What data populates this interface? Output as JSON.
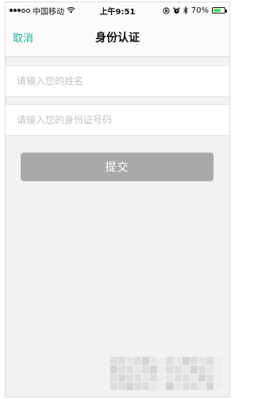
{
  "status_bar": {
    "carrier": "中国移动",
    "time": "上午9:51",
    "battery_percent": "70%",
    "battery_level": 0.7,
    "icons": [
      "signal-dots-icon",
      "wifi-icon",
      "lock-rotation-icon",
      "alarm-icon",
      "bluetooth-icon",
      "battery-icon"
    ]
  },
  "nav": {
    "cancel_label": "取消",
    "title": "身份认证"
  },
  "form": {
    "name_placeholder": "请输入您的姓名",
    "name_value": "",
    "id_placeholder": "请输入您的身份证号码",
    "id_value": "",
    "submit_label": "提交"
  },
  "colors": {
    "accent": "#1ab394",
    "submit_disabled_bg": "#a9a9a9",
    "page_bg": "#f2f2f2"
  }
}
